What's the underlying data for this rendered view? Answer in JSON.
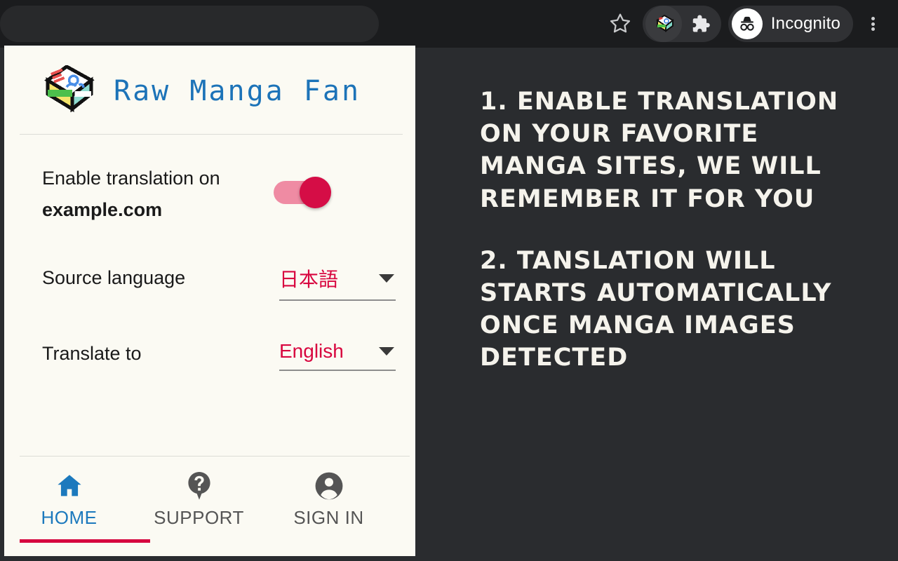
{
  "browser": {
    "bookmark_icon": "star-icon",
    "extension_icon": "manga-book-icon",
    "puzzle_icon": "puzzle-piece-icon",
    "profile_label": "Incognito",
    "profile_icon": "incognito-hat-glasses-icon",
    "menu_icon": "three-dot-menu-icon",
    "toolbar_bg": "#1b1c1e",
    "page_bg": "#2a2c2f"
  },
  "popup": {
    "background": "#fbfaf3",
    "logo_icon": "manga-book-logo",
    "title": "Raw Manga Fan",
    "title_color": "#1c73b8",
    "enable": {
      "label": "Enable translation on",
      "domain": "example.com",
      "toggle_state": "on",
      "toggle_track_color": "#ef8ba3",
      "toggle_thumb_color": "#d50d46"
    },
    "source_language": {
      "label": "Source language",
      "value": "日本語",
      "caret_icon": "chevron-down-icon"
    },
    "target_language": {
      "label": "Translate to",
      "value": "English",
      "caret_icon": "chevron-down-icon"
    },
    "value_color": "#d8063f",
    "nav": {
      "active_indicator_color": "#d6083f",
      "items": [
        {
          "label": "HOME",
          "icon": "home-icon",
          "active": true,
          "color": "#1c79bd"
        },
        {
          "label": "SUPPORT",
          "icon": "help-icon",
          "active": false,
          "color": "#555555"
        },
        {
          "label": "SIGN IN",
          "icon": "account-circle-icon",
          "active": false,
          "color": "#555555"
        }
      ]
    }
  },
  "instructions": {
    "step1": "1. ENABLE TRANSLATION ON YOUR FAVORITE MANGA SITES, WE WILL REMEMBER IT FOR YOU",
    "step2": "2. TANSLATION WILL STARTS AUTOMATICALLY ONCE MANGA IMAGES DETECTED"
  }
}
